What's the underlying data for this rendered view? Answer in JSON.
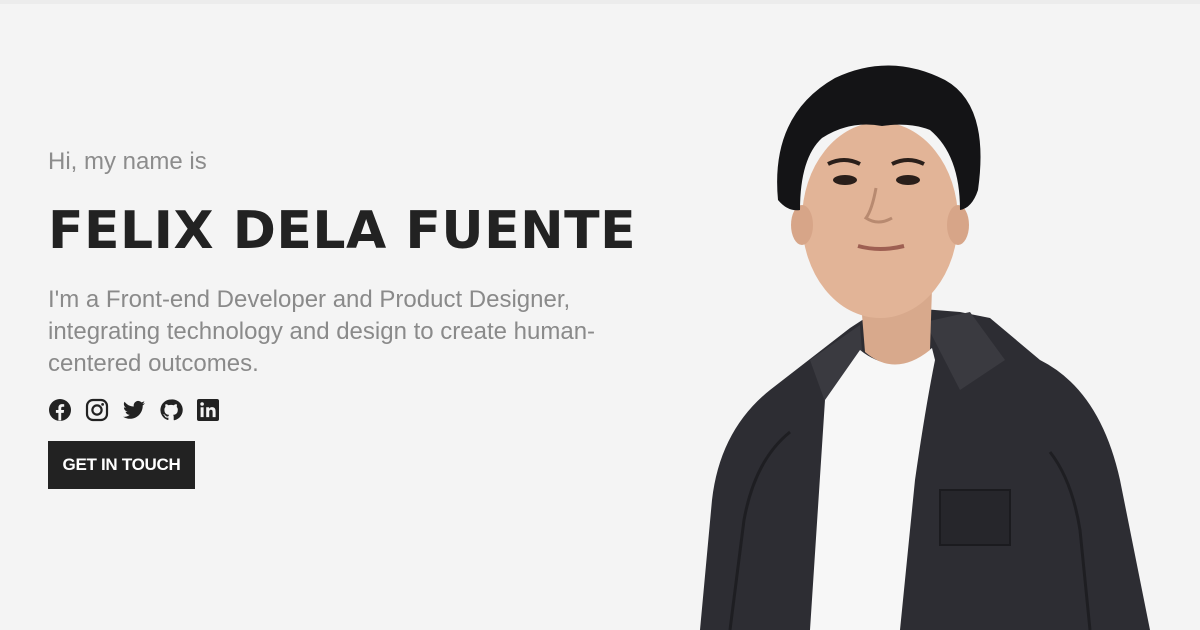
{
  "hero": {
    "greeting": "Hi, my name is",
    "name": "FELIX DELA FUENTE",
    "bio_lines": [
      "I'm a Front-end Developer and Product Designer,",
      "integrating technology and design to create human-",
      "centered outcomes."
    ],
    "cta_label": "GET IN TOUCH"
  },
  "socials": [
    {
      "icon": "facebook-icon"
    },
    {
      "icon": "instagram-icon"
    },
    {
      "icon": "twitter-icon"
    },
    {
      "icon": "github-icon"
    },
    {
      "icon": "linkedin-icon"
    }
  ],
  "colors": {
    "background": "#f4f4f4",
    "heading": "#222222",
    "muted_text": "#8a8a8a",
    "button_bg": "#222222",
    "button_text": "#ffffff"
  }
}
